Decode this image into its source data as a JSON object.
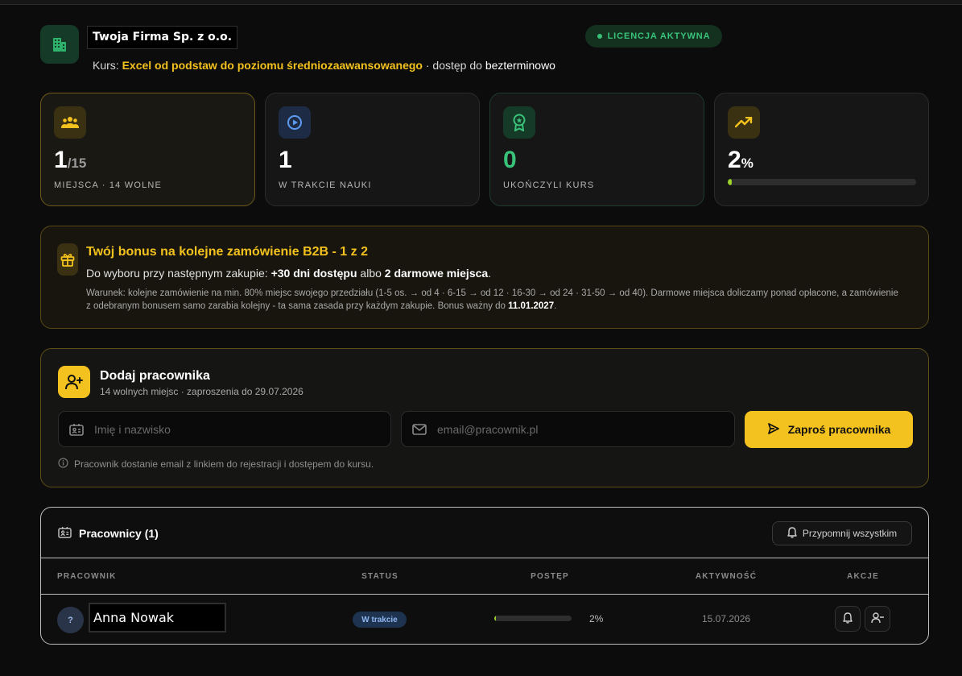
{
  "header": {
    "company_name": "Twoja Firma Sp. z o.o.",
    "license_badge": "LICENCJA AKTYWNA",
    "course_prefix": "Kurs:",
    "course_name": "Excel od podstaw do poziomu średniozaawansowanego",
    "access_prefix": "· dostęp do",
    "access_value": "bezterminowo"
  },
  "stats": {
    "seats": {
      "value": "1",
      "total": "/15",
      "label": "MIEJSCA · 14 WOLNE"
    },
    "learning": {
      "value": "1",
      "label": "W TRAKCIE NAUKI"
    },
    "completed": {
      "value": "0",
      "label": "UKOŃCZYLI KURS"
    },
    "progress": {
      "value": "2",
      "unit": "%",
      "fraction": 0.02
    }
  },
  "bonus": {
    "title": "Twój bonus na kolejne zamówienie B2B - 1 z 2",
    "choice_prefix": "Do wyboru przy następnym zakupie:",
    "choice_a": "+30 dni dostępu",
    "choice_or": "albo",
    "choice_b": "2 darmowe miejsca",
    "choice_end": ".",
    "conditions": "Warunek: kolejne zamówienie na min. 80% miejsc swojego przedziału (1-5 os. → od 4 · 6-15 → od 12 · 16-30 → od 24 · 31-50 → od 40). Darmowe miejsca doliczamy ponad opłacone, a zamówienie z odebranym bonusem samo zarabia kolejny - ta sama zasada przy każdym zakupie. Bonus ważny do",
    "valid_until": "11.01.2027",
    "conditions_end": "."
  },
  "add_employee": {
    "title": "Dodaj pracownika",
    "subtitle": "14 wolnych miejsc · zaproszenia do 29.07.2026",
    "name_placeholder": "Imię i nazwisko",
    "email_placeholder": "email@pracownik.pl",
    "invite_label": "Zaproś pracownika",
    "note": "Pracownik dostanie email z linkiem do rejestracji i dostępem do kursu."
  },
  "employees": {
    "title": "Pracownicy (1)",
    "remind_all_label": "Przypomnij wszystkim",
    "columns": [
      "PRACOWNIK",
      "STATUS",
      "POSTĘP",
      "AKTYWNOŚĆ",
      "AKCJE"
    ],
    "rows": [
      {
        "avatar": "?",
        "name": "Anna Nowak",
        "status": "W trakcie",
        "progress": "2%",
        "progress_fraction": 0.02,
        "activity": "15.07.2026"
      }
    ]
  },
  "colors": {
    "accent": "#f4c21e",
    "success": "#39c27a",
    "progress": "#9bd12a",
    "info": "#8fb6f0",
    "background": "#0c0c0c"
  },
  "icons": {
    "company": "building-icon",
    "seats": "users-icon",
    "learning": "play-circle-icon",
    "completed": "award-icon",
    "progress": "trending-up-icon",
    "bonus": "gift-icon",
    "add": "user-plus-icon",
    "name_field": "id-card-icon",
    "email_field": "mail-icon",
    "invite": "send-icon",
    "note": "info-icon",
    "table": "id-card-icon",
    "remind": "bell-icon",
    "row_remind": "bell-icon",
    "row_remove": "user-minus-icon"
  }
}
